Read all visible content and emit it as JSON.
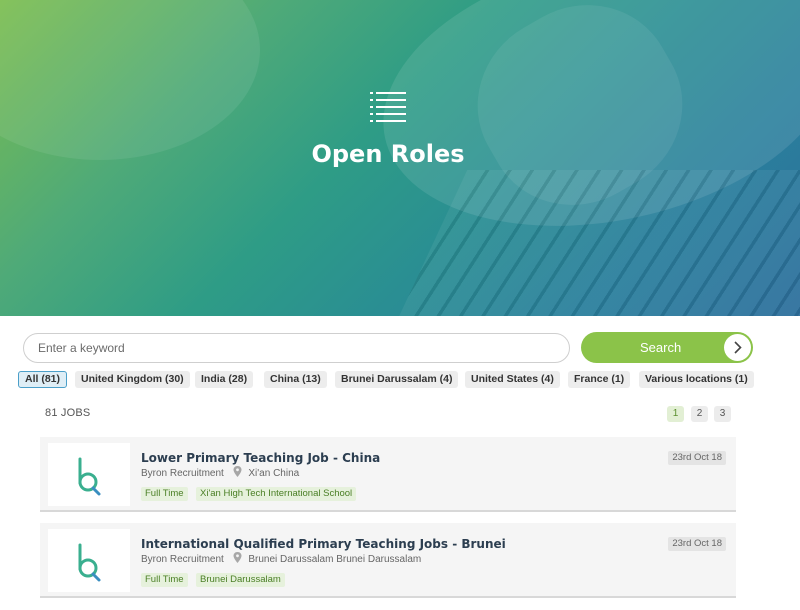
{
  "hero": {
    "title": "Open Roles",
    "icon": "list-icon"
  },
  "search": {
    "placeholder": "Enter a keyword",
    "button_label": "Search"
  },
  "filters": [
    {
      "label": "All (81)",
      "active": true
    },
    {
      "label": "United Kingdom (30)"
    },
    {
      "label": "India (28)"
    },
    {
      "label": "China (13)"
    },
    {
      "label": "Brunei Darussalam (4)"
    },
    {
      "label": "United States (4)"
    },
    {
      "label": "France (1)"
    },
    {
      "label": "Various locations (1)"
    }
  ],
  "results": {
    "count_label": "81 JOBS"
  },
  "pagination": {
    "pages": [
      "1",
      "2",
      "3"
    ],
    "current": "1"
  },
  "jobs": [
    {
      "title": "Lower Primary Teaching Job - China",
      "company": "Byron Recruitment",
      "location": "Xi'an China",
      "tags": [
        "Full Time",
        "Xi'an High Tech International School"
      ],
      "date": "23rd Oct 18"
    },
    {
      "title": "International Qualified Primary Teaching Jobs - Brunei",
      "company": "Byron Recruitment",
      "location": "Brunei Darussalam Brunei Darussalam",
      "tags": [
        "Full Time",
        "Brunei Darussalam"
      ],
      "date": "23rd Oct 18"
    }
  ],
  "colors": {
    "accent_green": "#8bc349",
    "logo_teal": "#3aaf8f",
    "logo_blue": "#3a8ec0"
  }
}
